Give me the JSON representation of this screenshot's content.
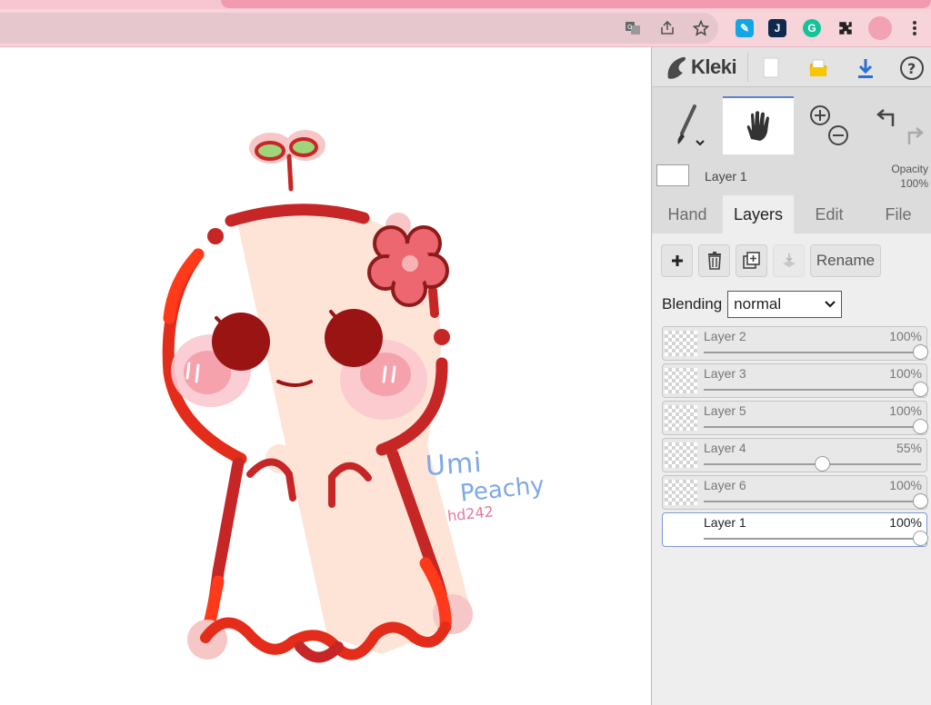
{
  "app": {
    "title": "Kleki",
    "top_actions": [
      {
        "name": "new-image",
        "icon": "blank-page-icon"
      },
      {
        "name": "open-file",
        "icon": "folder-icon"
      },
      {
        "name": "save-download",
        "icon": "download-icon"
      },
      {
        "name": "help",
        "icon": "help-icon"
      }
    ]
  },
  "tools": [
    {
      "name": "brush",
      "icon": "brush-icon",
      "active": false
    },
    {
      "name": "hand",
      "icon": "hand-icon",
      "active": true
    },
    {
      "name": "zoom",
      "icon": "zoom-in-out-icon",
      "active": false
    },
    {
      "name": "undo-redo",
      "icon": "undo-redo-icon",
      "active": false
    }
  ],
  "current_layer": {
    "name": "Layer 1",
    "opacity_label": "Opacity",
    "opacity_value": "100%"
  },
  "tabs": [
    {
      "label": "Hand",
      "active": false
    },
    {
      "label": "Layers",
      "active": true
    },
    {
      "label": "Edit",
      "active": false
    },
    {
      "label": "File",
      "active": false
    }
  ],
  "layers_panel": {
    "rename_label": "Rename",
    "blending_label": "Blending",
    "blending_value": "normal",
    "layers": [
      {
        "name": "Layer 2",
        "opacity": "100%",
        "level": 1.0,
        "selected": false
      },
      {
        "name": "Layer 3",
        "opacity": "100%",
        "level": 1.0,
        "selected": false
      },
      {
        "name": "Layer 5",
        "opacity": "100%",
        "level": 1.0,
        "selected": false
      },
      {
        "name": "Layer 4",
        "opacity": "55%",
        "level": 0.55,
        "selected": false
      },
      {
        "name": "Layer 6",
        "opacity": "100%",
        "level": 1.0,
        "selected": false
      },
      {
        "name": "Layer 1",
        "opacity": "100%",
        "level": 1.0,
        "selected": true
      }
    ]
  },
  "canvas": {
    "signature_line1": "Umi",
    "signature_line2": "Peachy",
    "signature_line3": "hd242"
  },
  "colors": {
    "accent": "#5b7fd6",
    "outline_red": "#c72626",
    "cheek_pink": "#f4a3ad",
    "flower": "#e8555f"
  }
}
